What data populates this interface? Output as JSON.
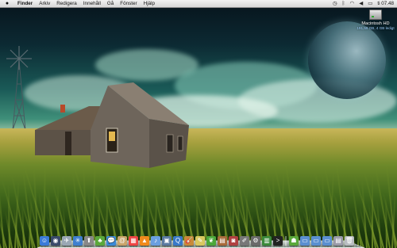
{
  "menubar": {
    "apple_icon": "apple-icon",
    "app_name": "Finder",
    "menus": [
      "Arkiv",
      "Redigera",
      "Innehåll",
      "Gå",
      "Fönster",
      "Hjälp"
    ],
    "status": {
      "clock": "ti 07.48",
      "icons": [
        "time-machine-icon",
        "bluetooth-icon",
        "wifi-icon",
        "volume-icon",
        "battery-icon"
      ]
    }
  },
  "desktop": {
    "hd": {
      "name": "Macintosh HD",
      "info": "191,59 GB, 4 GB ledigt"
    }
  },
  "dock": {
    "items": [
      {
        "name": "finder-icon",
        "color": "#3b7bd8",
        "glyph": "☺"
      },
      {
        "name": "dashboard-icon",
        "color": "#3a4a6a",
        "glyph": "◉"
      },
      {
        "name": "mail-icon",
        "color": "#9aa7b4",
        "glyph": "✈"
      },
      {
        "name": "safari-icon",
        "color": "#3f7fcf",
        "glyph": "✳"
      },
      {
        "name": "upload-icon",
        "color": "#888",
        "glyph": "⬆"
      },
      {
        "name": "adium-icon",
        "color": "#5aa83a",
        "glyph": "♣"
      },
      {
        "name": "ichat-icon",
        "color": "#3a8ad8",
        "glyph": "💬"
      },
      {
        "name": "address-book-icon",
        "color": "#c9a46a",
        "glyph": "@"
      },
      {
        "name": "calendar-icon",
        "color": "#e44",
        "glyph": "▦"
      },
      {
        "name": "vlc-icon",
        "color": "#f08a1c",
        "glyph": "▲"
      },
      {
        "name": "itunes-icon",
        "color": "#6a9fe0",
        "glyph": "♪"
      },
      {
        "name": "iphoto-icon",
        "color": "#5a7aa0",
        "glyph": "▣"
      },
      {
        "name": "quicktime-icon",
        "color": "#3878c8",
        "glyph": "Q"
      },
      {
        "name": "garageband-icon",
        "color": "#c88a3a",
        "glyph": "🎸"
      },
      {
        "name": "notes-icon",
        "color": "#d8c860",
        "glyph": "✎"
      },
      {
        "name": "leaf-icon",
        "color": "#4ba83a",
        "glyph": "❦"
      },
      {
        "name": "preview-icon",
        "color": "#a86a3a",
        "glyph": "▤"
      },
      {
        "name": "photo-booth-icon",
        "color": "#b04040",
        "glyph": "◙"
      },
      {
        "name": "pencil-icon",
        "color": "#777",
        "glyph": "✐"
      },
      {
        "name": "settings-icon",
        "color": "#6a6a6a",
        "glyph": "⚙"
      },
      {
        "name": "activity-icon",
        "color": "#3a8a3a",
        "glyph": "▥"
      },
      {
        "name": "terminal-icon",
        "color": "#222",
        "glyph": ">"
      }
    ],
    "right_items": [
      {
        "name": "android-app-icon",
        "color": "#5aa83a",
        "glyph": "☗"
      },
      {
        "name": "applications-folder-icon",
        "color": "#5a8fd0",
        "glyph": "▭"
      },
      {
        "name": "documents-folder-icon",
        "color": "#5a8fd0",
        "glyph": "▭"
      },
      {
        "name": "downloads-folder-icon",
        "color": "#5a8fd0",
        "glyph": "▭"
      },
      {
        "name": "stack-icon",
        "color": "#9a9aa8",
        "glyph": "▤"
      },
      {
        "name": "trash-icon",
        "color": "#b8bcc0",
        "glyph": "🗑"
      }
    ]
  }
}
